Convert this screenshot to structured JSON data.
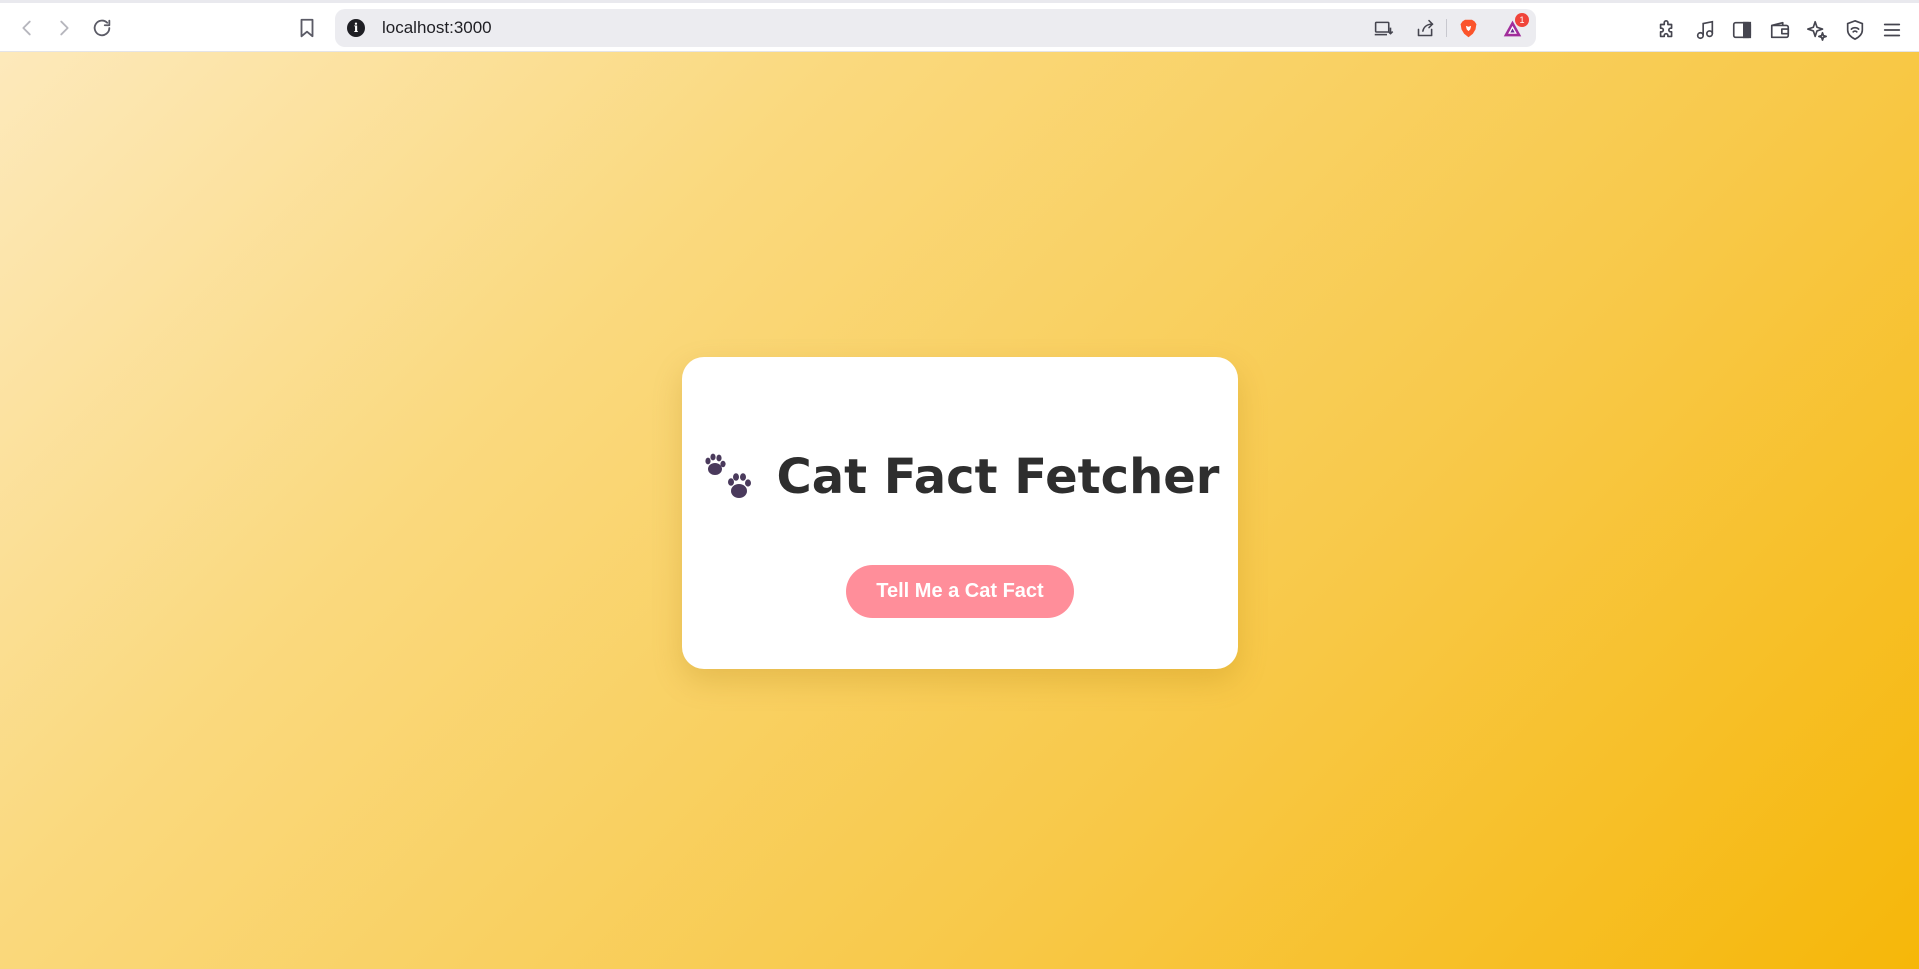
{
  "browser": {
    "url": "localhost:3000",
    "notification_count": "1",
    "icons": {
      "back": "back-arrow-icon",
      "forward": "forward-arrow-icon",
      "reload": "reload-icon",
      "bookmark": "bookmark-icon",
      "site_info": "info-icon",
      "install": "install-app-icon",
      "share": "share-icon",
      "brave_shields": "brave-lion-icon",
      "rewards": "brave-rewards-triangle-icon",
      "extensions": "puzzle-icon",
      "media": "music-note-icon",
      "sidebar": "sidebar-icon",
      "wallet": "wallet-icon",
      "leo": "sparkle-icon",
      "vpn": "shield-wifi-icon",
      "menu": "hamburger-menu-icon"
    }
  },
  "app": {
    "title": "Cat Fact Fetcher",
    "title_icon": "paw-prints-icon",
    "button_label": "Tell Me a Cat Fact"
  },
  "colors": {
    "button": "#ff8e9a",
    "gradient_start": "#fde9bb",
    "gradient_end": "#f6b709",
    "title_text": "#2e2e2e",
    "paw": "#4a3a5c"
  }
}
